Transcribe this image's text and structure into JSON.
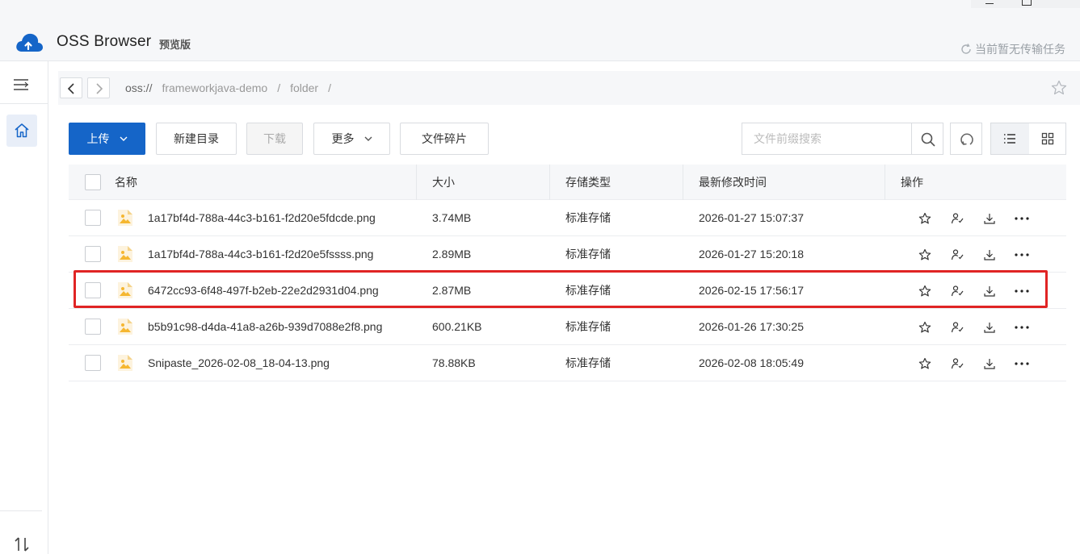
{
  "app": {
    "title": "OSS Browser",
    "edition": "预览版",
    "transfer_status": "当前暂无传输任务"
  },
  "address": {
    "scheme": "oss://",
    "segments": [
      "frameworkjava-demo",
      "folder"
    ],
    "separator": "/"
  },
  "toolbar": {
    "upload_label": "上传",
    "mkdir_label": "新建目录",
    "download_label": "下载",
    "more_label": "更多",
    "fragments_label": "文件碎片",
    "search_placeholder": "文件前缀搜索"
  },
  "table": {
    "columns": [
      "名称",
      "大小",
      "存储类型",
      "最新修改时间",
      "操作"
    ],
    "rows": [
      {
        "name": "1a17bf4d-788a-44c3-b161-f2d20e5fdcde.png",
        "size": "3.74MB",
        "storage": "标准存储",
        "modified": "2026-01-27 15:07:37"
      },
      {
        "name": "1a17bf4d-788a-44c3-b161-f2d20e5fssss.png",
        "size": "2.89MB",
        "storage": "标准存储",
        "modified": "2026-01-27 15:20:18"
      },
      {
        "name": "6472cc93-6f48-497f-b2eb-22e2d2931d04.png",
        "size": "2.87MB",
        "storage": "标准存储",
        "modified": "2026-02-15 17:56:17"
      },
      {
        "name": "b5b91c98-d4da-41a8-a26b-939d7088e2f8.png",
        "size": "600.21KB",
        "storage": "标准存储",
        "modified": "2026-01-26 17:30:25"
      },
      {
        "name": "Snipaste_2026-02-08_18-04-13.png",
        "size": "78.88KB",
        "storage": "标准存储",
        "modified": "2026-02-08 18:05:49"
      }
    ]
  },
  "colors": {
    "accent": "#1565c8",
    "highlight": "#e02424",
    "file_icon": "#f5b731"
  },
  "icons": [
    "cloud-logo-icon",
    "refresh-icon",
    "menu-icon",
    "home-icon",
    "sort-icon",
    "chevron-left-icon",
    "chevron-right-icon",
    "star-icon",
    "search-icon",
    "list-view-icon",
    "grid-view-icon",
    "image-file-icon",
    "share-user-icon",
    "download-icon",
    "more-icon"
  ]
}
